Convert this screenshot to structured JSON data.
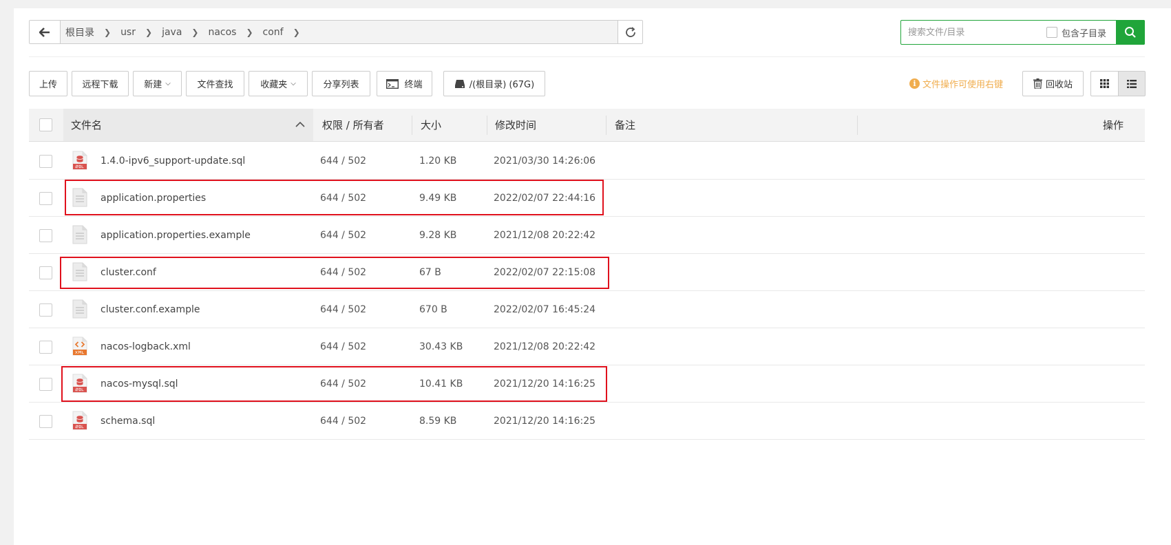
{
  "path": {
    "crumbs": [
      "根目录",
      "usr",
      "java",
      "nacos",
      "conf"
    ]
  },
  "search": {
    "placeholder": "搜索文件/目录",
    "subdir_label": "包含子目录"
  },
  "toolbar": {
    "upload": "上传",
    "remote_download": "远程下载",
    "new": "新建",
    "find": "文件查找",
    "favorites": "收藏夹",
    "share_list": "分享列表",
    "terminal": "终端",
    "disk": "/(根目录) (67G)",
    "tip": "文件操作可使用右键",
    "recycle": "回收站"
  },
  "table": {
    "headers": {
      "name": "文件名",
      "perm": "权限 / 所有者",
      "size": "大小",
      "mtime": "修改时间",
      "note": "备注",
      "ops": "操作"
    },
    "rows": [
      {
        "name": "1.4.0-ipv6_support-update.sql",
        "perm": "644 / 502",
        "size": "1.20 KB",
        "mtime": "2021/03/30 14:26:06",
        "icon": "sql-file-icon"
      },
      {
        "name": "application.properties",
        "perm": "644 / 502",
        "size": "9.49 KB",
        "mtime": "2022/02/07 22:44:16",
        "icon": "text-file-icon"
      },
      {
        "name": "application.properties.example",
        "perm": "644 / 502",
        "size": "9.28 KB",
        "mtime": "2021/12/08 20:22:42",
        "icon": "text-file-icon"
      },
      {
        "name": "cluster.conf",
        "perm": "644 / 502",
        "size": "67 B",
        "mtime": "2022/02/07 22:15:08",
        "icon": "text-file-icon"
      },
      {
        "name": "cluster.conf.example",
        "perm": "644 / 502",
        "size": "670 B",
        "mtime": "2022/02/07 16:45:24",
        "icon": "text-file-icon"
      },
      {
        "name": "nacos-logback.xml",
        "perm": "644 / 502",
        "size": "30.43 KB",
        "mtime": "2021/12/08 20:22:42",
        "icon": "xml-file-icon"
      },
      {
        "name": "nacos-mysql.sql",
        "perm": "644 / 502",
        "size": "10.41 KB",
        "mtime": "2021/12/20 14:16:25",
        "icon": "sql-file-icon"
      },
      {
        "name": "schema.sql",
        "perm": "644 / 502",
        "size": "8.59 KB",
        "mtime": "2021/12/20 14:16:25",
        "icon": "sql-file-icon"
      }
    ]
  },
  "colors": {
    "accent": "#20a53a",
    "highlight": "#e0101c",
    "tip": "#f0ad4e"
  }
}
